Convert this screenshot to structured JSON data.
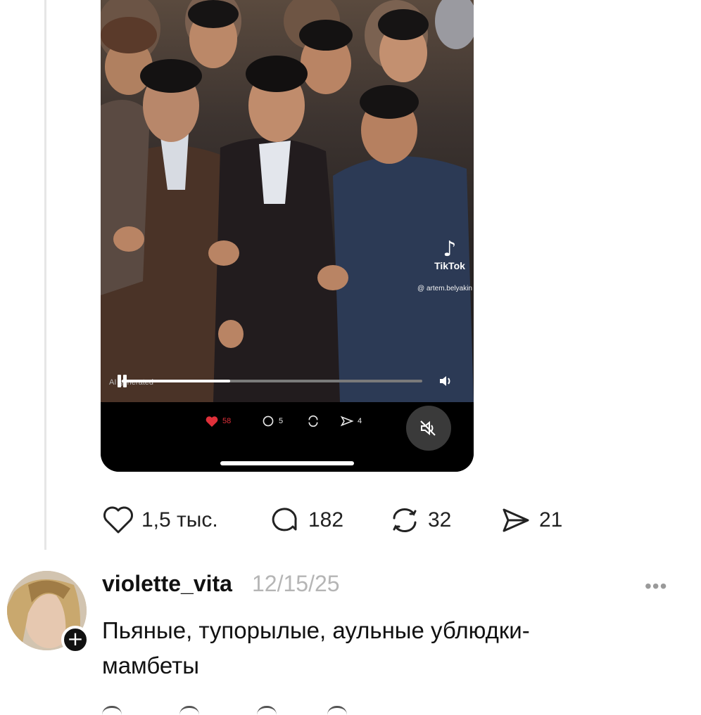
{
  "video": {
    "watermark_brand": "TikTok",
    "watermark_handle": "@ artem.belyakin",
    "ai_label": "AI generated",
    "progress": 0.36,
    "inner_likes": "58",
    "inner_comments": "5",
    "inner_shares": "4"
  },
  "actions": {
    "likes": "1,5 тыс.",
    "comments": "182",
    "reposts": "32",
    "shares": "21"
  },
  "comment": {
    "username": "violette_vita",
    "date": "12/15/25",
    "text": "Пьяные, тупорылые, аульные ублюдки-мамбеты",
    "more_label": "•••"
  },
  "icons": {
    "like": "heart-icon",
    "comment": "comment-bubble-icon",
    "repost": "repost-icon",
    "share": "send-icon",
    "follow": "plus-icon",
    "mute": "muted-speaker-icon"
  },
  "colors": {
    "inner_like_red": "#e0303a",
    "date_gray": "#b5b5b5"
  }
}
